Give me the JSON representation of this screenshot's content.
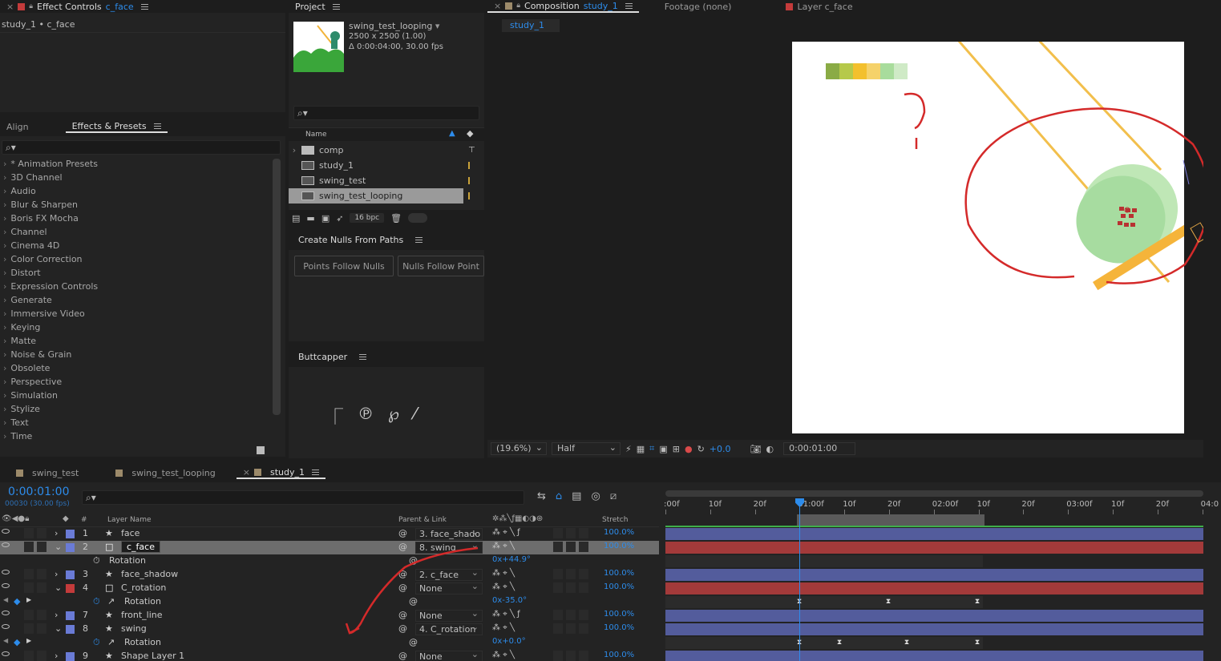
{
  "effect_controls": {
    "title": "Effect Controls",
    "layer": "c_face",
    "breadcrumb": "study_1 • c_face"
  },
  "effects_presets": {
    "tabs": [
      "Align",
      "Effects & Presets"
    ],
    "search_placeholder": "",
    "categories": [
      "* Animation Presets",
      "3D Channel",
      "Audio",
      "Blur & Sharpen",
      "Boris FX Mocha",
      "Channel",
      "Cinema 4D",
      "Color Correction",
      "Distort",
      "Expression Controls",
      "Generate",
      "Immersive Video",
      "Keying",
      "Matte",
      "Noise & Grain",
      "Obsolete",
      "Perspective",
      "Simulation",
      "Stylize",
      "Text",
      "Time"
    ]
  },
  "project": {
    "title": "Project",
    "selected_name": "swing_test_looping",
    "selected_info": [
      "2500 x 2500 (1.00)",
      "Δ 0:00:04:00, 30.00 fps"
    ],
    "column_name": "Name",
    "items": [
      {
        "name": "comp",
        "type": "folder"
      },
      {
        "name": "study_1",
        "type": "comp"
      },
      {
        "name": "swing_test",
        "type": "comp"
      },
      {
        "name": "swing_test_looping",
        "type": "comp",
        "selected": true
      }
    ],
    "bpc": "16 bpc"
  },
  "create_nulls": {
    "title": "Create Nulls From Paths",
    "buttons": [
      "Points Follow Nulls",
      "Nulls Follow Point"
    ]
  },
  "buttcapper": {
    "title": "Buttcapper"
  },
  "composition": {
    "title": "Composition",
    "comp_name": "study_1",
    "footage_tab": "Footage  (none)",
    "layer_tab": "Layer  c_face",
    "subtab": "study_1",
    "zoom": "(19.6%)",
    "resolution": "Half",
    "exposure": "+0.0",
    "timecode": "0:00:01:00",
    "swatches": [
      "#8aab45",
      "#b6c94a",
      "#f3c02d",
      "#f5d26a",
      "#a8dc9c",
      "#cfeac6"
    ]
  },
  "timeline": {
    "tabs": [
      "swing_test",
      "swing_test_looping",
      "study_1"
    ],
    "tab_colors": [
      "#9c8a6a",
      "#9c8a6a",
      "#9c8a6a"
    ],
    "current_time": "0:00:01:00",
    "frame_info": "00030 (30.00 fps)",
    "headers": {
      "hash": "#",
      "layer_name": "Layer Name",
      "parent": "Parent & Link",
      "stretch": "Stretch"
    },
    "ruler": [
      ":00f",
      "10f",
      "20f",
      "01:00f",
      "10f",
      "20f",
      "02:00f",
      "10f",
      "20f",
      "03:00f",
      "10f",
      "20f",
      "04:0"
    ],
    "layers": [
      {
        "kind": "layer",
        "num": "1",
        "name": "face",
        "color": "#6a7bd6",
        "star": true,
        "expanded": false,
        "parent": "3. face_shado",
        "stretch": "100.0%",
        "fx": true
      },
      {
        "kind": "layer",
        "num": "2",
        "name": "c_face",
        "color": "#6a7bd6",
        "star": false,
        "expanded": true,
        "parent": "8. swing",
        "stretch": "100.0%",
        "selected": true,
        "fx": false
      },
      {
        "kind": "prop",
        "name": "Rotation",
        "value": "0x+44.9°",
        "keyed": false
      },
      {
        "kind": "layer",
        "num": "3",
        "name": "face_shadow",
        "color": "#6a7bd6",
        "star": true,
        "expanded": false,
        "parent": "2. c_face",
        "stretch": "100.0%",
        "fx": false
      },
      {
        "kind": "layer",
        "num": "4",
        "name": "C_rotation",
        "color": "#c43b3b",
        "star": false,
        "expanded": true,
        "parent": "None",
        "stretch": "100.0%",
        "fx": false
      },
      {
        "kind": "prop",
        "name": "Rotation",
        "value": "0x-35.0°",
        "keyed": true
      },
      {
        "kind": "layer",
        "num": "7",
        "name": "front_line",
        "color": "#6a7bd6",
        "star": true,
        "expanded": false,
        "parent": "None",
        "stretch": "100.0%",
        "fx": true
      },
      {
        "kind": "layer",
        "num": "8",
        "name": "swing",
        "color": "#6a7bd6",
        "star": true,
        "expanded": true,
        "parent": "4. C_rotation",
        "stretch": "100.0%",
        "fx": false
      },
      {
        "kind": "prop",
        "name": "Rotation",
        "value": "0x+0.0°",
        "keyed": true
      },
      {
        "kind": "layer",
        "num": "9",
        "name": "Shape Layer 1",
        "color": "#6a7bd6",
        "star": true,
        "expanded": false,
        "parent": "None",
        "stretch": "100.0%",
        "fx": false
      }
    ],
    "bar_colors": [
      "#535c9c",
      "#a33a3a",
      null,
      "#535c9c",
      "#a33a3a",
      null,
      "#535c9c",
      "#535c9c",
      null,
      "#535c9c"
    ]
  }
}
